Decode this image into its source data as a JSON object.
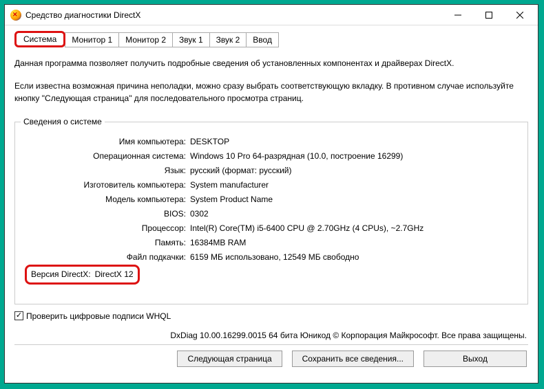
{
  "window": {
    "title": "Средство диагностики DirectX"
  },
  "tabs": {
    "system": "Система",
    "monitor1": "Монитор 1",
    "monitor2": "Монитор 2",
    "sound1": "Звук 1",
    "sound2": "Звук 2",
    "input": "Ввод"
  },
  "intro": {
    "line1": "Данная программа позволяет получить подробные сведения об установленных компонентах и драйверах DirectX.",
    "line2": "Если известна возможная причина неполадки, можно сразу выбрать соответствующую вкладку. В противном случае используйте кнопку \"Следующая страница\" для последовательного просмотра страниц."
  },
  "group_title": "Сведения о системе",
  "info": {
    "computer_name": {
      "label": "Имя компьютера:",
      "value": "DESKTOP"
    },
    "os": {
      "label": "Операционная система:",
      "value": "Windows 10 Pro 64-разрядная (10.0, построение 16299)"
    },
    "language": {
      "label": "Язык:",
      "value": "русский (формат: русский)"
    },
    "manufacturer": {
      "label": "Изготовитель компьютера:",
      "value": "System manufacturer"
    },
    "model": {
      "label": "Модель компьютера:",
      "value": "System Product Name"
    },
    "bios": {
      "label": "BIOS:",
      "value": "0302"
    },
    "processor": {
      "label": "Процессор:",
      "value": "Intel(R) Core(TM) i5-6400 CPU @ 2.70GHz (4 CPUs), ~2.7GHz"
    },
    "memory": {
      "label": "Память:",
      "value": "16384MB RAM"
    },
    "pagefile": {
      "label": "Файл подкачки:",
      "value": "6159 МБ использовано, 12549 МБ свободно"
    },
    "directx": {
      "label": "Версия DirectX:",
      "value": "DirectX 12"
    }
  },
  "whql_checkbox": "Проверить цифровые подписи WHQL",
  "footer_note": "DxDiag 10.00.16299.0015 64 бита Юникод © Корпорация Майкрософт. Все права защищены.",
  "buttons": {
    "next": "Следующая страница",
    "save": "Сохранить все сведения...",
    "exit": "Выход"
  }
}
